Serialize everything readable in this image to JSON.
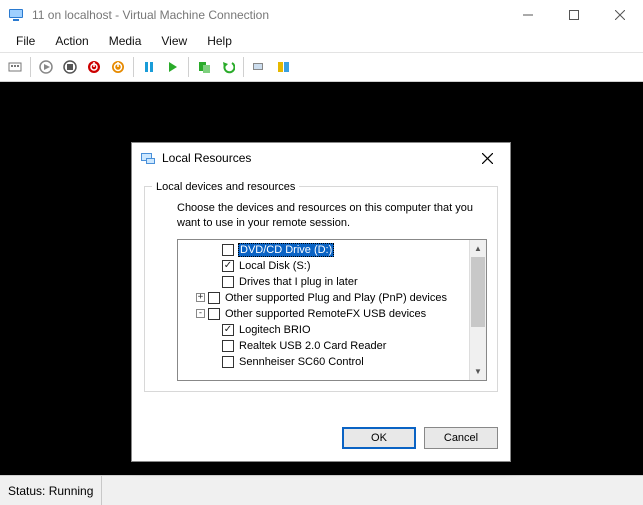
{
  "window": {
    "title": "11 on localhost - Virtual Machine Connection"
  },
  "menu": {
    "file": "File",
    "action": "Action",
    "media": "Media",
    "view": "View",
    "help": "Help"
  },
  "status": {
    "text": "Status: Running"
  },
  "dialog": {
    "title": "Local Resources",
    "group_label": "Local devices and resources",
    "description": "Choose the devices and resources on this computer that you want to use in your remote session.",
    "tree": {
      "dvd": {
        "label": "DVD/CD Drive (D:)",
        "checked": false,
        "selected": true
      },
      "local_disk": {
        "label": "Local Disk (S:)",
        "checked": true
      },
      "plug_later": {
        "label": "Drives that I plug in later",
        "checked": false
      },
      "pnp": {
        "label": "Other supported Plug and Play (PnP) devices",
        "checked": false
      },
      "remotefx": {
        "label": "Other supported RemoteFX USB devices",
        "checked": false
      },
      "brio": {
        "label": "Logitech BRIO",
        "checked": true
      },
      "realtek": {
        "label": "Realtek USB 2.0 Card Reader",
        "checked": false
      },
      "sennheiser": {
        "label": "Sennheiser SC60 Control",
        "checked": false
      }
    },
    "ok": "OK",
    "cancel": "Cancel"
  }
}
